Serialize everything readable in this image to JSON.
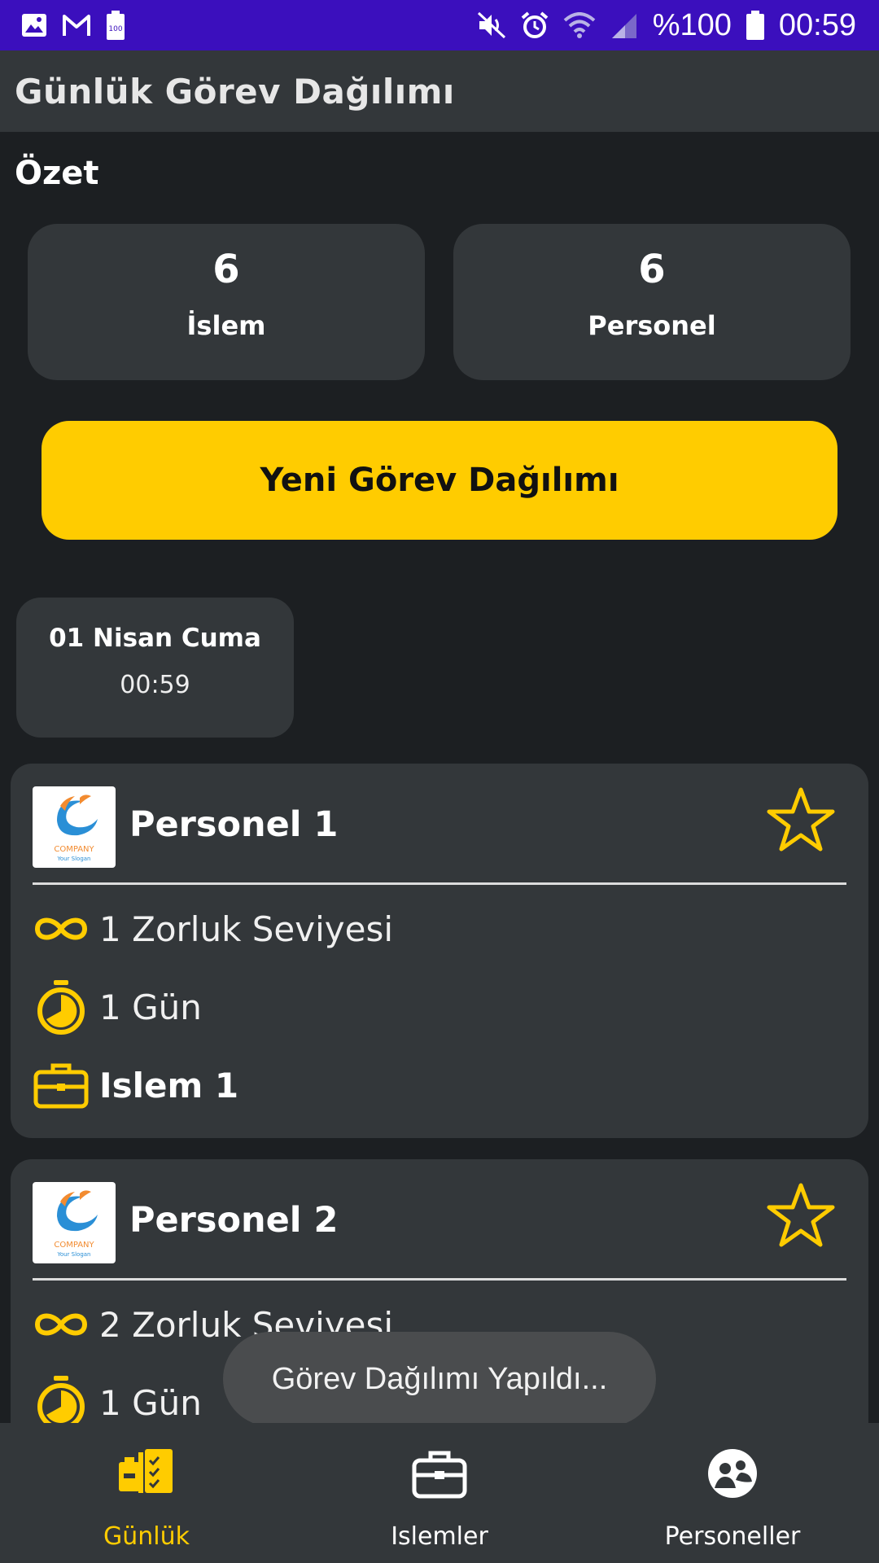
{
  "status_bar": {
    "battery_text": "%100",
    "time": "00:59",
    "icons": [
      "gallery-icon",
      "gmail-icon",
      "battery-saver-icon",
      "mute-icon",
      "alarm-icon",
      "wifi-icon",
      "signal-icon",
      "battery-icon"
    ]
  },
  "app_bar": {
    "title": "Günlük Görev Dağılımı"
  },
  "summary": {
    "title": "Özet",
    "cards": [
      {
        "value": "6",
        "label": "İslem"
      },
      {
        "value": "6",
        "label": "Personel"
      }
    ]
  },
  "new_assignment_button": "Yeni Görev Dağılımı",
  "date_card": {
    "date": "01 Nisan Cuma",
    "time": "00:59"
  },
  "staff": [
    {
      "name": "Personel 1",
      "difficulty": "1 Zorluk Seviyesi",
      "duration": "1 Gün",
      "task": "Islem 1"
    },
    {
      "name": "Personel 2",
      "difficulty": "2 Zorluk Seviyesi",
      "duration": "1 Gün",
      "task": ""
    }
  ],
  "logo": {
    "company": "COMPANY",
    "slogan": "Your Slogan"
  },
  "toast": "Görev Dağılımı Yapıldı...",
  "bottom_nav": {
    "items": [
      {
        "label": "Günlük",
        "icon": "daily-tasks-icon",
        "active": true
      },
      {
        "label": "Islemler",
        "icon": "briefcase-icon",
        "active": false
      },
      {
        "label": "Personeller",
        "icon": "people-icon",
        "active": false
      }
    ]
  },
  "colors": {
    "accent": "#ffcc00",
    "status_bar": "#3b0fbd",
    "card": "#33373a",
    "background": "#1c1f22"
  }
}
